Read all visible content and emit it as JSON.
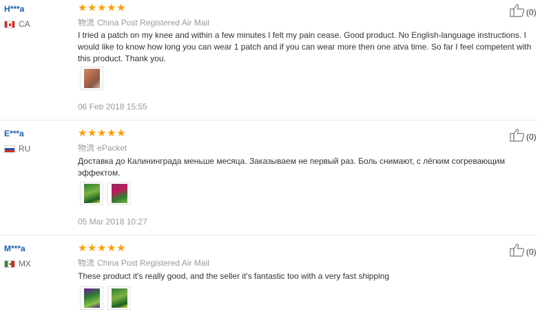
{
  "reviews": [
    {
      "user": "H***a",
      "country": "CA",
      "flag_icon": "canada-flag-icon",
      "rating": 5,
      "logistics_label": "物流",
      "carrier": "China Post Registered Air Mail",
      "text": "I tried a patch on my knee and within a few minutes I felt my pain cease. Good product. No English-language instructions. I would like to know how long you can wear 1 patch and if you can wear more then one atva time. So far I feel competent with this product. Thank you.",
      "date": "06 Feb 2018 15:55",
      "likes": "(0)"
    },
    {
      "user": "E***a",
      "country": "RU",
      "flag_icon": "russia-flag-icon",
      "rating": 5,
      "logistics_label": "物流",
      "carrier": "ePacket",
      "text": "Доставка до Калининграда меньше месяца. Заказываем не первый раз. Боль снимают, с лёгким согревающим эффектом.",
      "date": "05 Mar 2018 10:27",
      "likes": "(0)"
    },
    {
      "user": "M***a",
      "country": "MX",
      "flag_icon": "mexico-flag-icon",
      "rating": 5,
      "logistics_label": "物流",
      "carrier": "China Post Registered Air Mail",
      "text": "These product it's really good, and the seller it's fantastic too with a very fast shipping",
      "likes": "(0)"
    }
  ],
  "colors": {
    "username": "#1a5fa8",
    "star": "#ff9c00",
    "muted": "#999999"
  }
}
